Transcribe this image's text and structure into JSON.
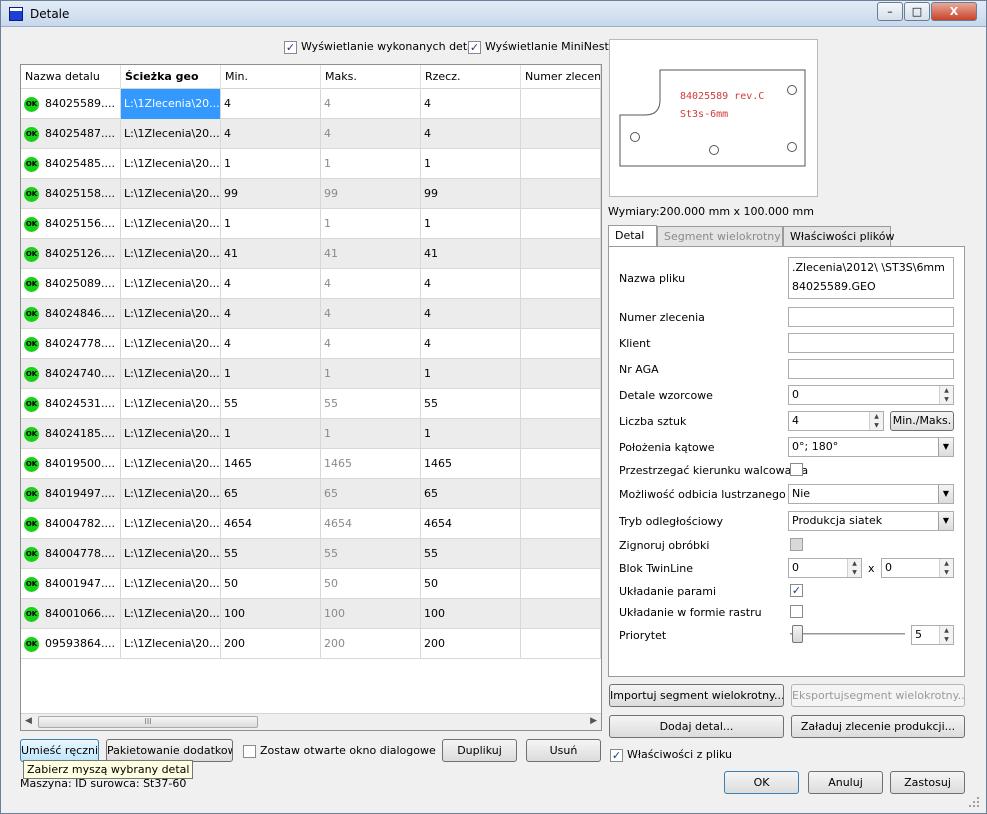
{
  "window": {
    "title": "Detale",
    "controls": {
      "minimize": "–",
      "maximize": "□",
      "close": "X"
    }
  },
  "top_options": {
    "show_done": {
      "label": "Wyświetlanie wykonanych detali",
      "checked": true
    },
    "show_mininests": {
      "label": "Wyświetlanie MiniNests",
      "checked": true
    }
  },
  "table": {
    "columns": [
      "Nazwa detalu",
      "Ścieżka geo",
      "Min.",
      "Maks.",
      "Rzecz.",
      "Numer zleceni"
    ],
    "status_icon_text": "OK",
    "rows": [
      {
        "name": "84025589....",
        "path": "L:\\1Zlecenia\\20...",
        "min": "4",
        "max": "4",
        "actual": "4",
        "order": ""
      },
      {
        "name": "84025487....",
        "path": "L:\\1Zlecenia\\20...",
        "min": "4",
        "max": "4",
        "actual": "4",
        "order": ""
      },
      {
        "name": "84025485....",
        "path": "L:\\1Zlecenia\\20...",
        "min": "1",
        "max": "1",
        "actual": "1",
        "order": ""
      },
      {
        "name": "84025158....",
        "path": "L:\\1Zlecenia\\20...",
        "min": "99",
        "max": "99",
        "actual": "99",
        "order": ""
      },
      {
        "name": "84025156....",
        "path": "L:\\1Zlecenia\\20...",
        "min": "1",
        "max": "1",
        "actual": "1",
        "order": ""
      },
      {
        "name": "84025126....",
        "path": "L:\\1Zlecenia\\20...",
        "min": "41",
        "max": "41",
        "actual": "41",
        "order": ""
      },
      {
        "name": "84025089....",
        "path": "L:\\1Zlecenia\\20...",
        "min": "4",
        "max": "4",
        "actual": "4",
        "order": ""
      },
      {
        "name": "84024846....",
        "path": "L:\\1Zlecenia\\20...",
        "min": "4",
        "max": "4",
        "actual": "4",
        "order": ""
      },
      {
        "name": "84024778....",
        "path": "L:\\1Zlecenia\\20...",
        "min": "4",
        "max": "4",
        "actual": "4",
        "order": ""
      },
      {
        "name": "84024740....",
        "path": "L:\\1Zlecenia\\20...",
        "min": "1",
        "max": "1",
        "actual": "1",
        "order": ""
      },
      {
        "name": "84024531....",
        "path": "L:\\1Zlecenia\\20...",
        "min": "55",
        "max": "55",
        "actual": "55",
        "order": ""
      },
      {
        "name": "84024185....",
        "path": "L:\\1Zlecenia\\20...",
        "min": "1",
        "max": "1",
        "actual": "1",
        "order": ""
      },
      {
        "name": "84019500....",
        "path": "L:\\1Zlecenia\\20...",
        "min": "1465",
        "max": "1465",
        "actual": "1465",
        "order": ""
      },
      {
        "name": "84019497....",
        "path": "L:\\1Zlecenia\\20...",
        "min": "65",
        "max": "65",
        "actual": "65",
        "order": ""
      },
      {
        "name": "84004782....",
        "path": "L:\\1Zlecenia\\20...",
        "min": "4654",
        "max": "4654",
        "actual": "4654",
        "order": ""
      },
      {
        "name": "84004778....",
        "path": "L:\\1Zlecenia\\20...",
        "min": "55",
        "max": "55",
        "actual": "55",
        "order": ""
      },
      {
        "name": "84001947....",
        "path": "L:\\1Zlecenia\\20...",
        "min": "50",
        "max": "50",
        "actual": "50",
        "order": ""
      },
      {
        "name": "84001066....",
        "path": "L:\\1Zlecenia\\20...",
        "min": "100",
        "max": "100",
        "actual": "100",
        "order": ""
      },
      {
        "name": "09593864....",
        "path": "L:\\1Zlecenia\\20...",
        "min": "200",
        "max": "200",
        "actual": "200",
        "order": ""
      }
    ],
    "selected_row_index": 0,
    "scroll_thumb_glyph": "III"
  },
  "left_buttons": {
    "place_manually": "Umieść ręcznie",
    "extra_packing": "Pakietowanie dodatkowe",
    "keep_open": {
      "label": "Zostaw otwarte okno dialogowe",
      "checked": false
    },
    "duplicate": "Duplikuj",
    "delete": "Usuń"
  },
  "tooltip": "Zabierz myszą wybrany detal",
  "status_bar": "Maszyna:   ID surowca: St37-60",
  "preview": {
    "part_text_line1": "84025589 rev.C",
    "part_text_line2": "St3s-6mm",
    "part_text_color": "#d23a3a",
    "dimensions": "Wymiary:200.000 mm x 100.000 mm"
  },
  "tabs": [
    "Detal",
    "Segment wielokrotny",
    "Właściwości plików"
  ],
  "active_tab": 0,
  "detail_form": {
    "file_name": {
      "label": "Nazwa pliku",
      "line1": ".Zlecenia\\2012\\        \\ST3S\\6mm",
      "line2": "84025589.GEO"
    },
    "order_number": {
      "label": "Numer zlecenia",
      "value": ""
    },
    "client": {
      "label": "Klient",
      "value": ""
    },
    "aga": {
      "label": "Nr AGA",
      "value": ""
    },
    "template_parts": {
      "label": "Detale wzorcowe",
      "value": "0"
    },
    "quantity": {
      "label": "Liczba sztuk",
      "value": "4",
      "button": "Min./Maks."
    },
    "angles": {
      "label": "Położenia kątowe",
      "value": "0°; 180°"
    },
    "rolling_direction": {
      "label": "Przestrzegać kierunku walcowania",
      "checked": false
    },
    "mirror": {
      "label": "Możliwość odbicia lustrzanego",
      "value": "Nie"
    },
    "distance_mode": {
      "label": "Tryb odległościowy",
      "value": "Produkcja siatek"
    },
    "ignore_processing": {
      "label": "Zignoruj obróbki",
      "checked": false
    },
    "twinline": {
      "label": "Blok TwinLine",
      "value_a": "0",
      "separator": "x",
      "value_b": "0"
    },
    "pair_nesting": {
      "label": "Układanie parami",
      "checked": true
    },
    "raster_nesting": {
      "label": "Układanie w formie rastru",
      "checked": false
    },
    "priority": {
      "label": "Priorytet",
      "value": "5",
      "level": 0
    }
  },
  "right_buttons": {
    "import_segment": "Importuj segment wielokrotny...",
    "export_segment": "Eksportujsegment wielokrotny...",
    "add_detail": "Dodaj detal...",
    "load_order": "Załaduj zlecenie produkcji...",
    "props_from_file": {
      "label": "Właściwości z pliku",
      "checked": true
    }
  },
  "dialog_buttons": {
    "ok": "OK",
    "cancel": "Anuluj",
    "apply": "Zastosuj"
  },
  "colors": {
    "selection": "#3399ff",
    "ok_icon": "#19d119",
    "title_icon": "#1c3fd6"
  }
}
